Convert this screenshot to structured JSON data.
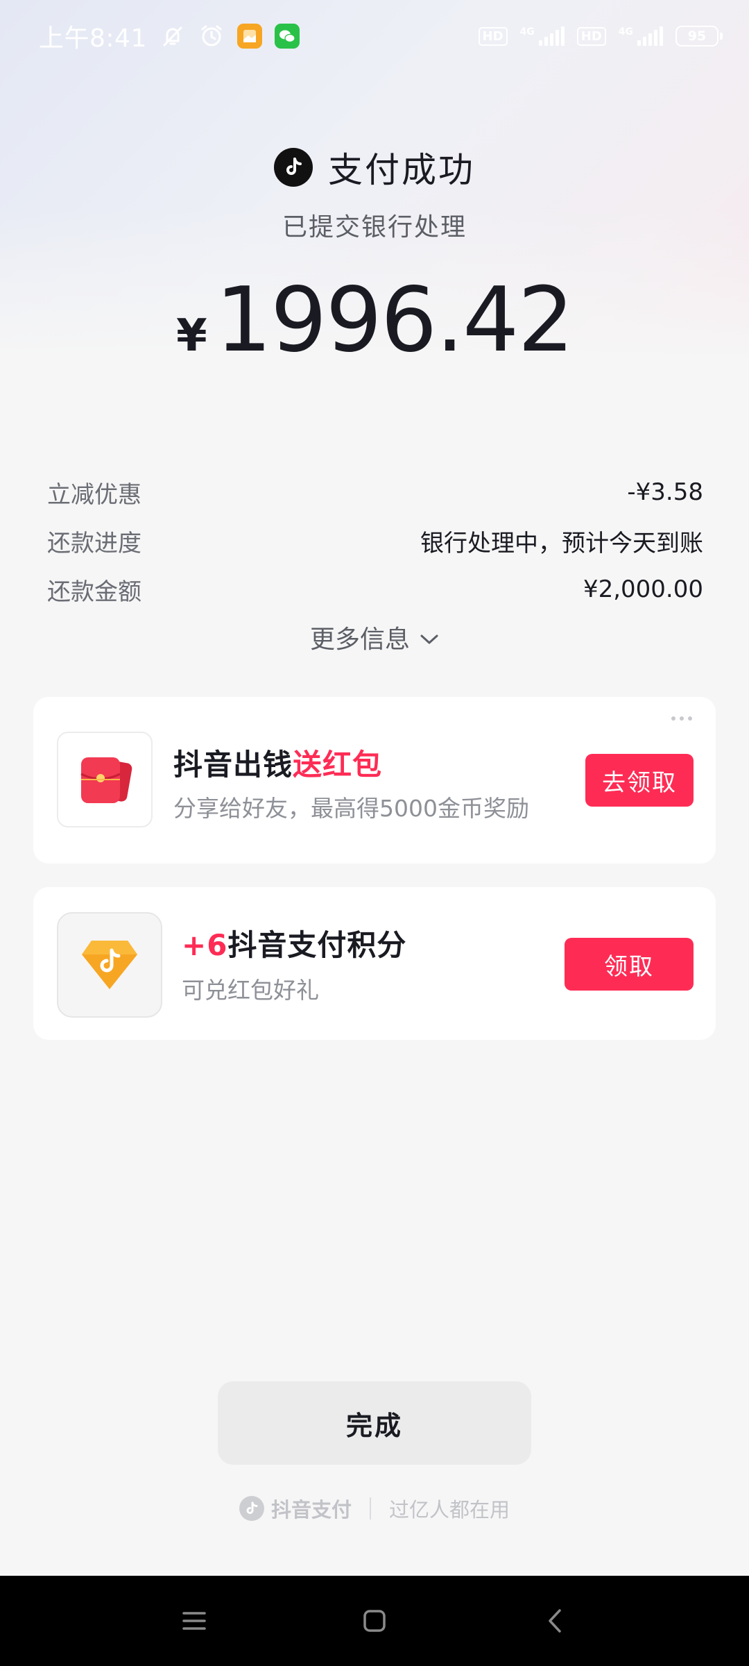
{
  "status_bar": {
    "time": "上午8:41",
    "icons": [
      "bell-off-icon",
      "alarm-icon",
      "gallery-app-icon",
      "wechat-icon"
    ],
    "hd1": "HD",
    "sig1_label": "4G",
    "hd2": "HD",
    "sig2_label": "4G",
    "battery": "95"
  },
  "header": {
    "title": "支付成功",
    "subtitle": "已提交银行处理",
    "currency": "¥",
    "amount": "1996.42"
  },
  "details": [
    {
      "label": "立减优惠",
      "value": "-¥3.58"
    },
    {
      "label": "还款进度",
      "value": "银行处理中，预计今天到账"
    },
    {
      "label": "还款金额",
      "value": "¥2,000.00"
    }
  ],
  "more_info": "更多信息",
  "promo_card": {
    "title_main": "抖音出钱",
    "title_accent": "送红包",
    "subtitle": "分享给好友，最高得5000金币奖励",
    "button": "去领取"
  },
  "points_card": {
    "title_accent": "+6",
    "title_main": "抖音支付积分",
    "subtitle": "可兑红包好礼",
    "button": "领取"
  },
  "done_button": "完成",
  "footer": {
    "brand": "抖音支付",
    "slogan": "过亿人都在用"
  },
  "colors": {
    "accent": "#fe2c55",
    "text_primary": "#1a1b22",
    "text_secondary": "#6b6d75",
    "background": "#f6f6f6"
  }
}
